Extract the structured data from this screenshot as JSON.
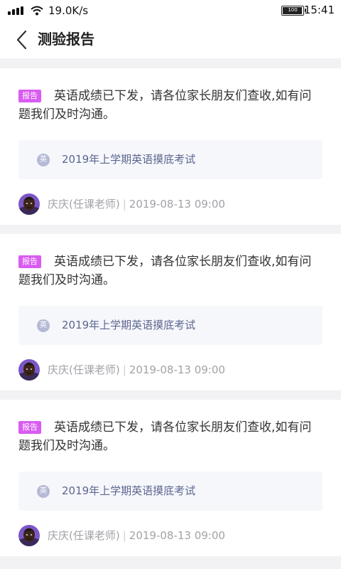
{
  "status_bar": {
    "net_speed": "19.0K/s",
    "battery_level": "100",
    "time": "15:41"
  },
  "nav": {
    "back_icon": "chevron-left-icon",
    "title": "测验报告"
  },
  "colors": {
    "tag_bg": "#d95cf2",
    "exam_text": "#5c6690",
    "meta_text": "#a2a2a8"
  },
  "cards": [
    {
      "tag": "报告",
      "message": "英语成绩已下发，请各位家长朋友们查收,如有问题我们及时沟通。",
      "subject_badge": "英",
      "exam_title": "2019年上学期英语摸底考试",
      "teacher": "庆庆(任课老师)",
      "separator": "|",
      "datetime": "2019-08-13 09:00"
    },
    {
      "tag": "报告",
      "message": "英语成绩已下发，请各位家长朋友们查收,如有问题我们及时沟通。",
      "subject_badge": "英",
      "exam_title": "2019年上学期英语摸底考试",
      "teacher": "庆庆(任课老师)",
      "separator": "|",
      "datetime": "2019-08-13 09:00"
    },
    {
      "tag": "报告",
      "message": "英语成绩已下发，请各位家长朋友们查收,如有问题我们及时沟通。",
      "subject_badge": "英",
      "exam_title": "2019年上学期英语摸底考试",
      "teacher": "庆庆(任课老师)",
      "separator": "|",
      "datetime": "2019-08-13 09:00"
    }
  ]
}
